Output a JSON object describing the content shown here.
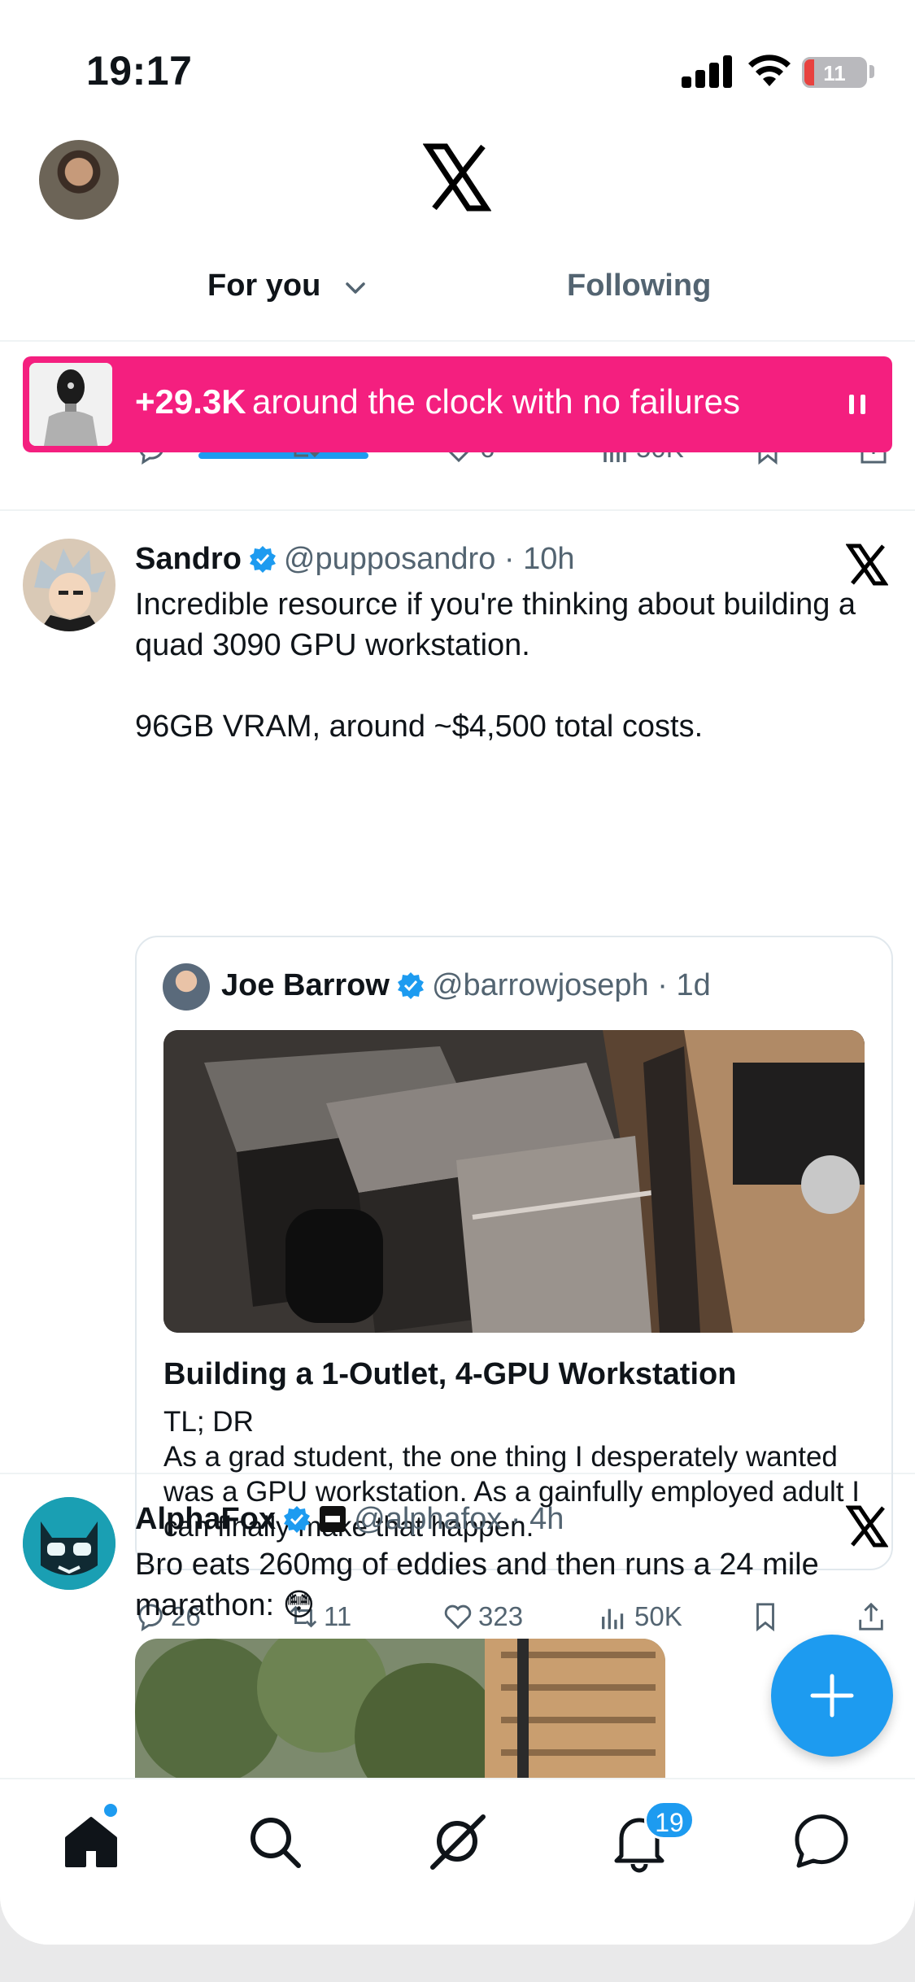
{
  "status_bar": {
    "time": "19:17",
    "battery": "11"
  },
  "header": {
    "tabs": [
      {
        "label": "For you"
      },
      {
        "label": "Following"
      }
    ]
  },
  "banner": {
    "count": "+29.3K",
    "text": "around the clock with no failures"
  },
  "previous_tweet_actions": {
    "likes": "6",
    "views": "50K"
  },
  "tweets": [
    {
      "name": "Sandro",
      "handle": "@pupposandro",
      "time": "10h",
      "text": "Incredible resource if you're thinking about building a  quad 3090 GPU workstation.\n\n96GB VRAM, around ~$4,500 total costs.",
      "quote": {
        "name": "Joe Barrow",
        "handle": "@barrowjoseph",
        "time": "1d",
        "title": "Building a 1-Outlet, 4-GPU Workstation",
        "body": "TL; DR\nAs a grad student, the one thing I desperately wanted was a GPU workstation. As a gainfully employed adult I can finally make that happen."
      },
      "actions": {
        "replies": "26",
        "reposts": "11",
        "likes": "323",
        "views": "50K"
      }
    },
    {
      "name": "AlphaFox",
      "handle": "@alphafox",
      "time": "4h",
      "text": "Bro eats 260mg of eddies and then runs a 24 mile marathon: 😳"
    }
  ],
  "nav": {
    "notifications_badge": "19"
  },
  "colors": {
    "accent": "#1d9bf0",
    "banner": "#f41f7f",
    "muted": "#536471"
  },
  "icons": [
    "x-logo-icon",
    "verified-icon",
    "reply-icon",
    "repost-icon",
    "like-icon",
    "views-icon",
    "bookmark-icon",
    "share-icon",
    "home-icon",
    "search-icon",
    "grok-icon",
    "bell-icon",
    "messages-icon",
    "compose-icon"
  ]
}
